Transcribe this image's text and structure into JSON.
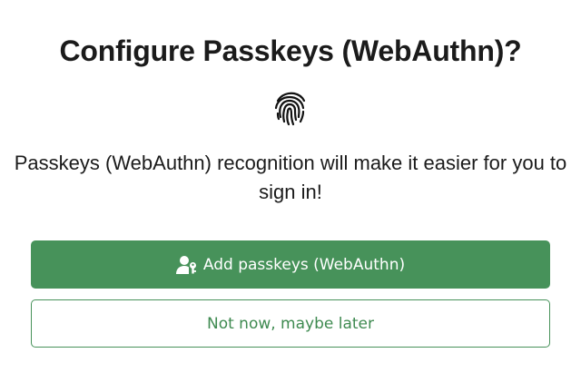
{
  "dialog": {
    "title": "Configure Passkeys (WebAuthn)?",
    "icon": "fingerprint-icon",
    "description": "Passkeys (WebAuthn) recognition will make it easier for you to sign in!",
    "primary_button": {
      "label": "Add passkeys (WebAuthn)",
      "icon": "user-key-icon"
    },
    "secondary_button": {
      "label": "Not now, maybe later"
    }
  },
  "colors": {
    "accent": "#47925a",
    "text": "#1b1b1b",
    "background": "#ffffff"
  }
}
